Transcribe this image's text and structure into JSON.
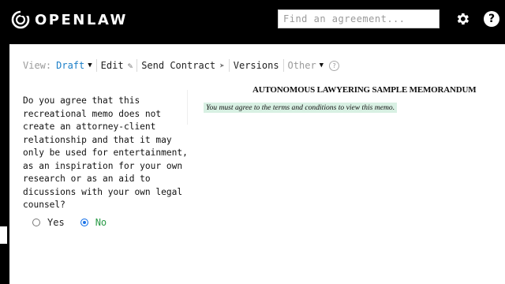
{
  "header": {
    "logo_text": "OPENLAW",
    "search_placeholder": "Find an agreement...",
    "settings_icon": "gear-icon",
    "help_icon": "question-icon",
    "help_glyph": "?"
  },
  "toolbar": {
    "view_label": "View:",
    "view_value": "Draft",
    "edit_label": "Edit",
    "send_label": "Send Contract",
    "versions_label": "Versions",
    "other_label": "Other",
    "help_glyph": "?"
  },
  "form": {
    "question": "Do you agree that this recreational memo does not create an attorney-client relationship and that it may only be used for entertainment, as an inspiration for your own research or as an aid to dicussions with your own legal counsel?",
    "options": [
      "Yes",
      "No"
    ],
    "selected": "No"
  },
  "document": {
    "title": "AUTONOMOUS LAWYERING SAMPLE MEMORANDUM",
    "notice": "You must agree to the terms and conditions to view this memo."
  },
  "colors": {
    "accent_blue": "#1a7ec8",
    "answer_green": "#2a9b47",
    "notice_bg": "#d8f0e3"
  }
}
